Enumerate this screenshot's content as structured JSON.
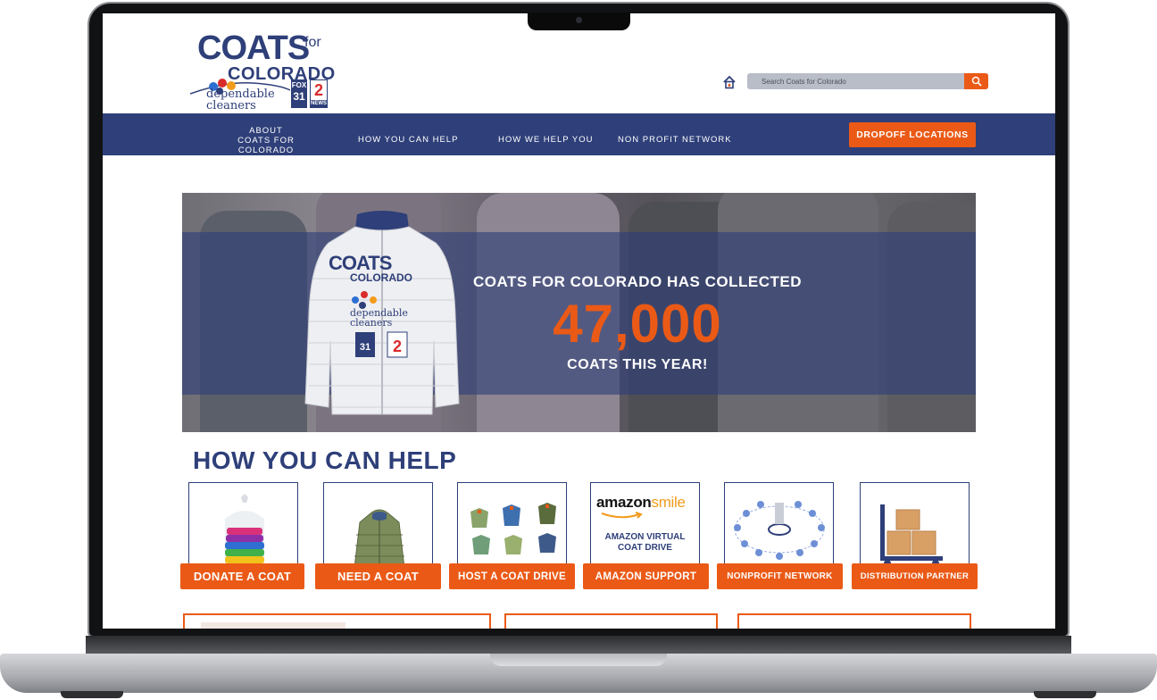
{
  "header": {
    "logo": {
      "coats": "COATS",
      "for": "for",
      "colorado": "COLORADO",
      "dependable": "dependable",
      "cleaners": "cleaners",
      "fox": "FOX",
      "fox_num": "31",
      "channel_num": "2",
      "news": "NEWS"
    },
    "search": {
      "placeholder": "Search Coats for Colorado"
    }
  },
  "nav": {
    "about_line1": "ABOUT",
    "about_line2": "COATS FOR COLORADO",
    "how_you_can_help": "HOW YOU CAN HELP",
    "how_we_help_you": "HOW WE HELP YOU",
    "non_profit_network": "NON PROFIT NETWORK",
    "dropoff": "DROPOFF LOCATIONS"
  },
  "hero": {
    "line1": "COATS FOR COLORADO HAS COLLECTED",
    "number": "47,000",
    "line2": "COATS THIS YEAR!"
  },
  "help": {
    "title": "HOW YOU CAN HELP",
    "amazon_word_bold": "amazon",
    "amazon_word_light": "smile",
    "amazon_sub_line1": "AMAZON VIRTUAL",
    "amazon_sub_line2": "COAT DRIVE",
    "cards": [
      {
        "label": "DONATE A COAT"
      },
      {
        "label": "NEED A COAT"
      },
      {
        "label": "HOST A COAT DRIVE"
      },
      {
        "label": "AMAZON SUPPORT"
      },
      {
        "label": "NONPROFIT NETWORK"
      },
      {
        "label": "DISTRIBUTION PARTNER"
      }
    ]
  },
  "colors": {
    "brand_navy": "#2e3f79",
    "brand_orange": "#ea5a16"
  }
}
